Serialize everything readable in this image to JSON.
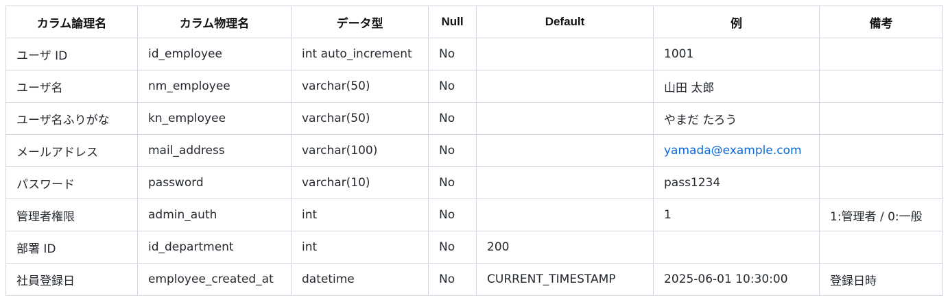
{
  "table": {
    "headers": [
      "カラム論理名",
      "カラム物理名",
      "データ型",
      "Null",
      "Default",
      "例",
      "備考"
    ],
    "rows": [
      [
        "ユーザ ID",
        "id_employee",
        "int auto_increment",
        "No",
        "",
        "1001",
        ""
      ],
      [
        "ユーザ名",
        "nm_employee",
        "varchar(50)",
        "No",
        "",
        "山田 太郎",
        ""
      ],
      [
        "ユーザ名ふりがな",
        "kn_employee",
        "varchar(50)",
        "No",
        "",
        "やまだ たろう",
        ""
      ],
      [
        "メールアドレス",
        "mail_address",
        "varchar(100)",
        "No",
        "",
        "yamada@example.com",
        ""
      ],
      [
        "パスワード",
        "password",
        "varchar(10)",
        "No",
        "",
        "pass1234",
        ""
      ],
      [
        "管理者権限",
        "admin_auth",
        "int",
        "No",
        "",
        "1",
        "1:管理者 / 0:一般"
      ],
      [
        "部署 ID",
        "id_department",
        "int",
        "No",
        "200",
        "",
        ""
      ],
      [
        "社員登録日",
        "employee_created_at",
        "datetime",
        "No",
        "CURRENT_TIMESTAMP",
        "2025-06-01 10:30:00",
        "登録日時"
      ]
    ]
  },
  "colors": {
    "border": "#d0d7de",
    "link": "#0969da"
  }
}
